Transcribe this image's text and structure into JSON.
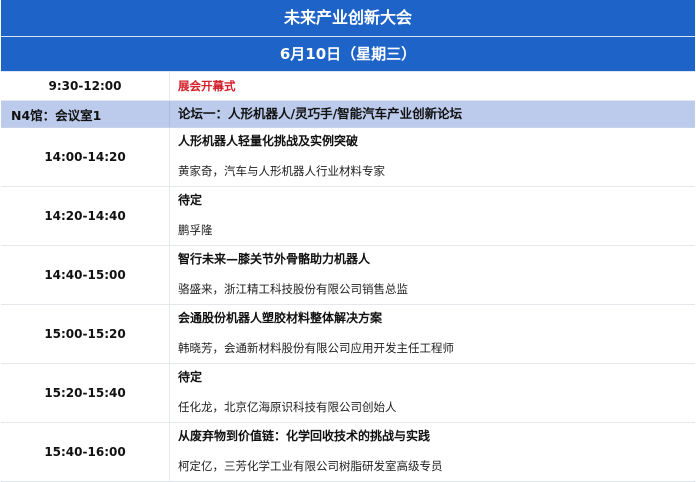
{
  "header": {
    "title": "未来产业创新大会",
    "date": "6月10日（星期三）"
  },
  "opening": {
    "time": "9:30-12:00",
    "label": "展会开幕式"
  },
  "venue": {
    "name": "N4馆：会议室1",
    "forum": "论坛一：人形机器人/灵巧手/智能汽车产业创新论坛"
  },
  "sessions": [
    {
      "time": "14:00-14:20",
      "topic": "人形机器人轻量化挑战及实例突破",
      "speaker": "黄家奇，汽车与人形机器人行业材料专家"
    },
    {
      "time": "14:20-14:40",
      "topic": "待定",
      "speaker": "鹏孚隆"
    },
    {
      "time": "14:40-15:00",
      "topic": "智行未来—膝关节外骨骼助力机器人",
      "speaker": "骆盛来，浙江精工科技股份有限公司销售总监"
    },
    {
      "time": "15:00-15:20",
      "topic": "会通股份机器人塑胶材料整体解决方案",
      "speaker": "韩晓芳，会通新材料股份有限公司应用开发主任工程师"
    },
    {
      "time": "15:20-15:40",
      "topic": "待定",
      "speaker": "任化龙，北京亿海原识科技有限公司创始人"
    },
    {
      "time": "15:40-16:00",
      "topic": "从废弃物到价值链：化学回收技术的挑战与实践",
      "speaker": "柯定亿，三芳化学工业有限公司树脂研发室高级专员"
    }
  ]
}
